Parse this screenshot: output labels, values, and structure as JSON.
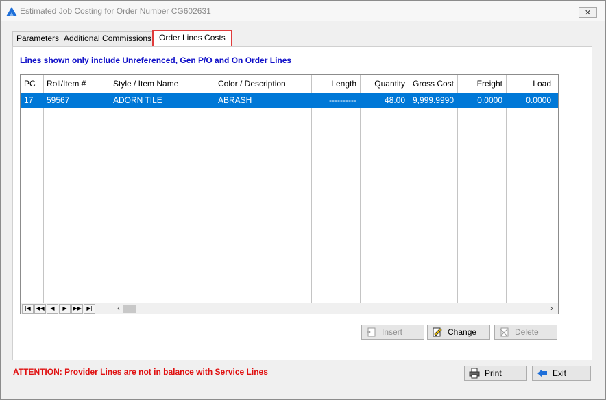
{
  "window": {
    "title": "Estimated Job Costing for Order Number CG602631",
    "close_glyph": "✕"
  },
  "tabs": [
    {
      "label": "Parameters",
      "active": false
    },
    {
      "label": "Additional Commissions",
      "active": false
    },
    {
      "label": "Order Lines Costs",
      "active": true
    }
  ],
  "panel": {
    "info_text": "Lines shown only include Unreferenced, Gen P/O and On Order Lines"
  },
  "grid": {
    "columns": [
      "PC",
      "Roll/Item #",
      "Style / Item Name",
      "Color / Description",
      "Length",
      "Quantity",
      "Gross Cost",
      "Freight",
      "Load"
    ],
    "rows": [
      [
        "17",
        "59567",
        "ADORN TILE",
        "ABRASH",
        "----------",
        "48.00",
        "9,999.9990",
        "0.0000",
        "0.0000"
      ]
    ],
    "nav": [
      "|◀",
      "◀◀",
      "◀",
      "▶",
      "▶▶",
      "▶|"
    ]
  },
  "buttons": {
    "insert": {
      "label": "Insert",
      "icon": "insert-row-icon",
      "enabled": false
    },
    "change": {
      "label": "Change",
      "icon": "edit-pencil-icon",
      "enabled": true
    },
    "delete": {
      "label": "Delete",
      "icon": "delete-row-icon",
      "enabled": false
    },
    "print": {
      "label": "Print",
      "icon": "printer-icon",
      "enabled": true
    },
    "exit": {
      "label": "Exit",
      "icon": "arrow-left-icon",
      "enabled": true
    }
  },
  "attention_text": "ATTENTION: Provider Lines are not in balance with Service Lines",
  "colors": {
    "selection": "#0078d7",
    "info_text": "#1010c8",
    "attention_text": "#e01010",
    "active_tab_border": "#e03c3c",
    "app_icon": "#1e6fd9"
  }
}
